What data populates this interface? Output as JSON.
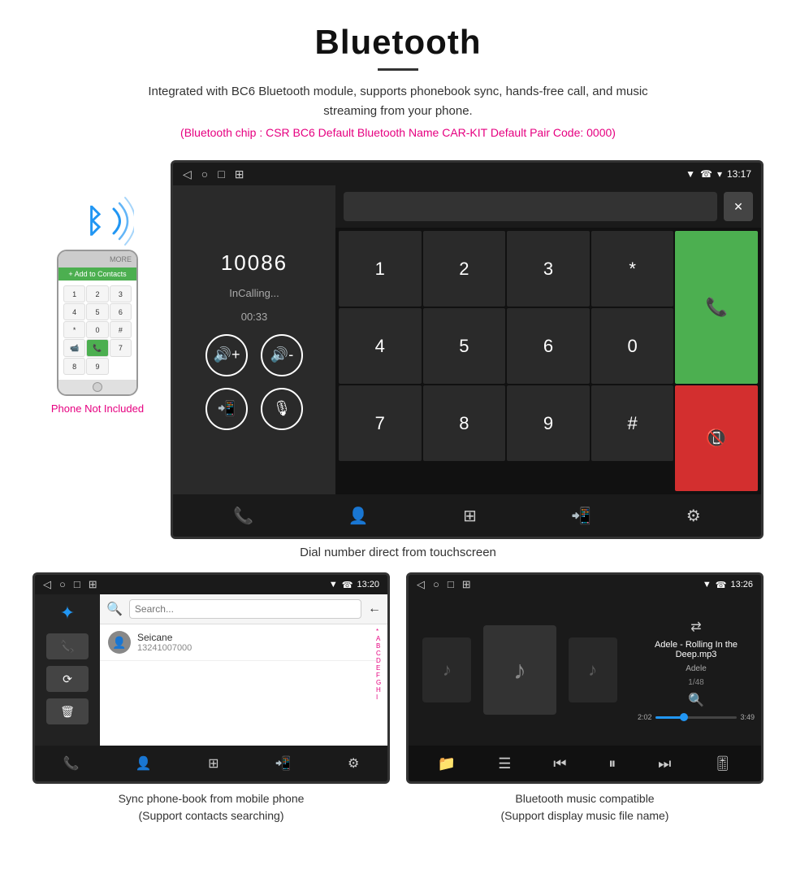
{
  "header": {
    "title": "Bluetooth",
    "subtitle": "Integrated with BC6 Bluetooth module, supports phonebook sync, hands-free call, and music streaming from your phone.",
    "specs": "(Bluetooth chip : CSR BC6    Default Bluetooth Name CAR-KIT    Default Pair Code: 0000)"
  },
  "main_screen": {
    "status_bar": {
      "nav_icons": [
        "◁",
        "○",
        "□",
        "⊞"
      ],
      "right_icons": "▼ ☎ ▾",
      "time": "13:17"
    },
    "dialer": {
      "number": "10086",
      "status": "InCalling...",
      "timer": "00:33",
      "vol_up": "🔊+",
      "vol_down": "🔊-",
      "transfer": "📲",
      "mute": "🎙"
    },
    "keypad": {
      "keys": [
        "1",
        "2",
        "3",
        "*",
        "4",
        "5",
        "6",
        "0",
        "7",
        "8",
        "9",
        "#"
      ]
    },
    "bottom_bar_icons": [
      "📞",
      "👤",
      "⊞",
      "📲",
      "⚙"
    ]
  },
  "caption_main": "Dial number direct from touchscreen",
  "phone_illustration": {
    "not_included": "Phone Not Included"
  },
  "phonebook_screen": {
    "status_time": "13:20",
    "contact_name": "Seicane",
    "contact_number": "13241007000",
    "alphabet": [
      "*",
      "A",
      "B",
      "C",
      "D",
      "E",
      "F",
      "G",
      "H",
      "I"
    ]
  },
  "music_screen": {
    "status_time": "13:26",
    "song_title": "Adele - Rolling In the Deep.mp3",
    "artist": "Adele",
    "track_info": "1/48",
    "time_current": "2:02",
    "time_total": "3:49"
  },
  "caption_phonebook": {
    "line1": "Sync phone-book from mobile phone",
    "line2": "(Support contacts searching)"
  },
  "caption_music": {
    "line1": "Bluetooth music compatible",
    "line2": "(Support display music file name)"
  }
}
